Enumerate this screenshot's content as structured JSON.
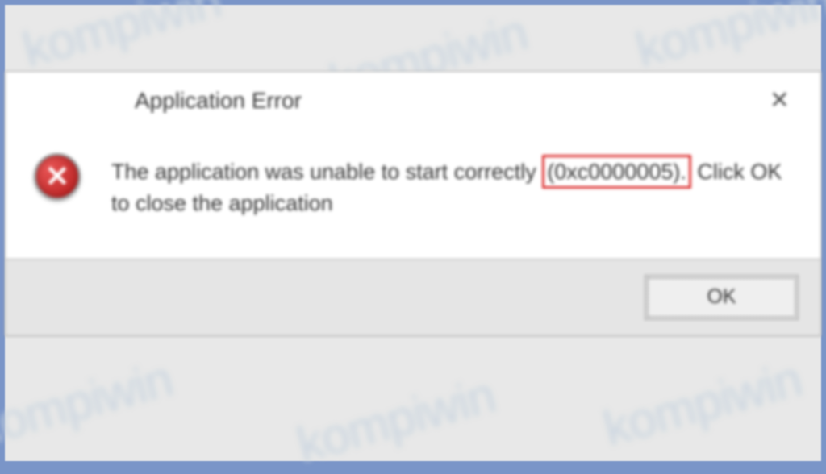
{
  "dialog": {
    "title": "Application Error",
    "message_part1": "The application was unable to start correctly ",
    "error_code": "(0xc0000005).",
    "message_part2": " Click OK to close the application",
    "ok_label": "OK"
  },
  "watermark": {
    "text": "kompiwin"
  }
}
